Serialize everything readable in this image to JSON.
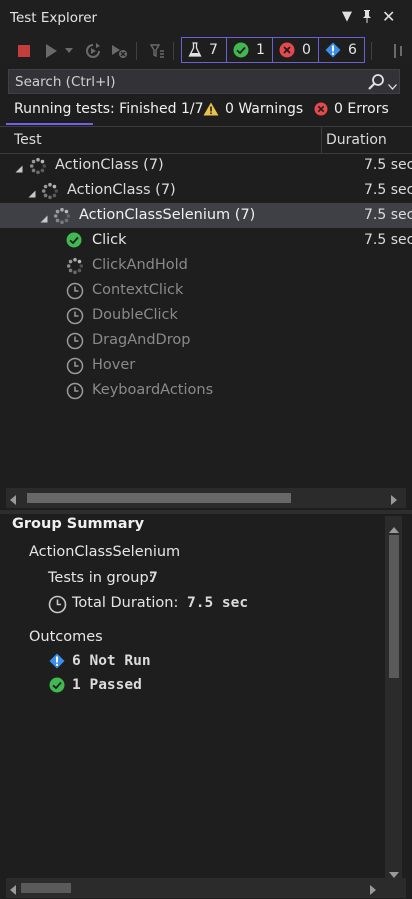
{
  "window": {
    "title": "Test Explorer"
  },
  "counters": {
    "total": "7",
    "passed": "1",
    "failed": "0",
    "not_run": "6"
  },
  "search": {
    "placeholder": "Search (Ctrl+I)"
  },
  "status": {
    "text": "Running tests: Finished 1/7",
    "warnings": "0 Warnings",
    "errors": "0 Errors"
  },
  "columns": {
    "test": "Test",
    "duration": "Duration"
  },
  "tree": [
    {
      "name": "ActionClass",
      "count": "(7)",
      "duration": "7.5 sec",
      "state": "running"
    },
    {
      "name": "ActionClass",
      "count": "(7)",
      "duration": "7.5 sec",
      "state": "running"
    },
    {
      "name": "ActionClassSelenium",
      "count": "(7)",
      "duration": "7.5 sec",
      "state": "running"
    },
    {
      "name": "Click",
      "duration": "7.5 sec",
      "state": "passed"
    },
    {
      "name": "ClickAndHold",
      "duration": "",
      "state": "running"
    },
    {
      "name": "ContextClick",
      "duration": "",
      "state": "pending"
    },
    {
      "name": "DoubleClick",
      "duration": "",
      "state": "pending"
    },
    {
      "name": "DragAndDrop",
      "duration": "",
      "state": "pending"
    },
    {
      "name": "Hover",
      "duration": "",
      "state": "pending"
    },
    {
      "name": "KeyboardActions",
      "duration": "",
      "state": "pending"
    }
  ],
  "summary": {
    "title": "Group Summary",
    "group_name": "ActionClassSelenium",
    "tests_in_group_label": "Tests in group:",
    "tests_in_group_value": "7",
    "total_duration_label": "Total Duration:",
    "total_duration_value": "7.5 sec",
    "outcomes_label": "Outcomes",
    "outcomes": [
      {
        "count": "6",
        "label": "Not Run",
        "icon": "info-icon"
      },
      {
        "count": "1",
        "label": "Passed",
        "icon": "check-icon"
      }
    ]
  },
  "colors": {
    "accent": "#6b61d6",
    "passed": "#3fb950",
    "failed": "#e5484d",
    "info": "#3b8eea",
    "warning": "#e8c34a"
  }
}
